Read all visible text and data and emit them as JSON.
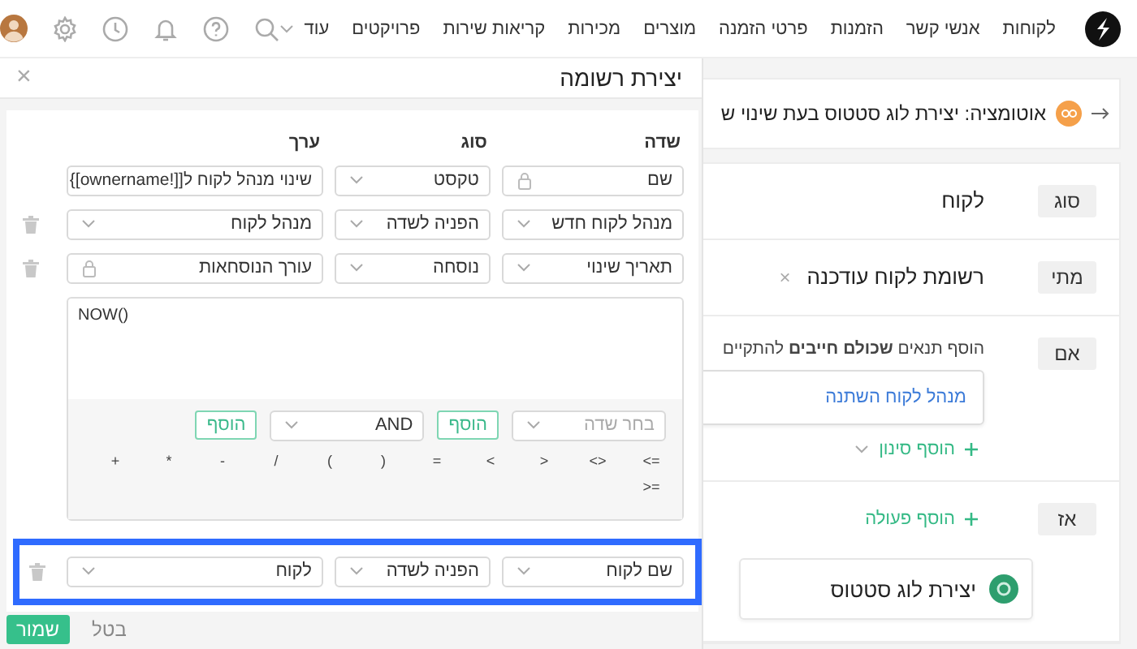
{
  "nav": {
    "items": [
      "לקוחות",
      "אנשי קשר",
      "הזמנות",
      "פרטי הזמנה",
      "מוצרים",
      "מכירות",
      "קריאות שירות",
      "פרויקטים"
    ],
    "more": "עוד"
  },
  "modal": {
    "title": "יצירת רשומה",
    "close": "×",
    "columns": [
      "שדה",
      "סוג",
      "ערך"
    ],
    "rows": [
      {
        "field": {
          "text": "שם",
          "kind": "locked"
        },
        "type": {
          "text": "טקסט",
          "kind": "select"
        },
        "value": {
          "text": "שינוי מנהל לקוח ל[[!ownername]}",
          "kind": "expression"
        },
        "deletable": false,
        "highlighted": false
      },
      {
        "field": {
          "text": "מנהל לקוח חדש",
          "kind": "select"
        },
        "type": {
          "text": "הפניה לשדה",
          "kind": "select"
        },
        "value": {
          "text": "מנהל לקוח",
          "kind": "select"
        },
        "deletable": true,
        "highlighted": false
      },
      {
        "field": {
          "text": "תאריך שינוי",
          "kind": "select"
        },
        "type": {
          "text": "נוסחה",
          "kind": "select"
        },
        "value": {
          "text": "עורך הנוסחאות",
          "kind": "locked"
        },
        "deletable": true,
        "highlighted": false,
        "formula": {
          "text": "NOW()",
          "field_select": {
            "placeholder": "בחר שדה"
          },
          "add_field": "הוסף",
          "operator_select": {
            "value": "AND"
          },
          "add_operator": "הוסף",
          "operators": [
            "<=",
            "<>",
            ">",
            "<",
            "=",
            ")",
            "(",
            "/",
            "-",
            "*",
            "+",
            ">="
          ]
        }
      },
      {
        "field": {
          "text": "שם לקוח",
          "kind": "select"
        },
        "type": {
          "text": "הפניה לשדה",
          "kind": "select"
        },
        "value": {
          "text": "לקוח",
          "kind": "select"
        },
        "deletable": true,
        "highlighted": true
      }
    ],
    "save": "שמור",
    "cancel": "בטל"
  },
  "automation": {
    "title": "אוטומציה: יצירת לוג סטטוס בעת שינוי ש",
    "sections": [
      {
        "kind": "text",
        "label": "סוג",
        "text": "לקוח"
      },
      {
        "kind": "removable",
        "label": "מתי",
        "text": "רשומת לקוח עודכנה",
        "remove": "×"
      },
      {
        "kind": "conditions",
        "label": "אם",
        "hint": "הוסף תנאים **שכולם חייבים** להתקיים",
        "conditions": [
          "מנהל לקוח השתנה"
        ],
        "add": "הוסף סינון"
      },
      {
        "kind": "actions",
        "label": "אז",
        "add": "הוסף פעולה",
        "actions": [
          "יצירת לוג סטטוס"
        ]
      }
    ]
  }
}
